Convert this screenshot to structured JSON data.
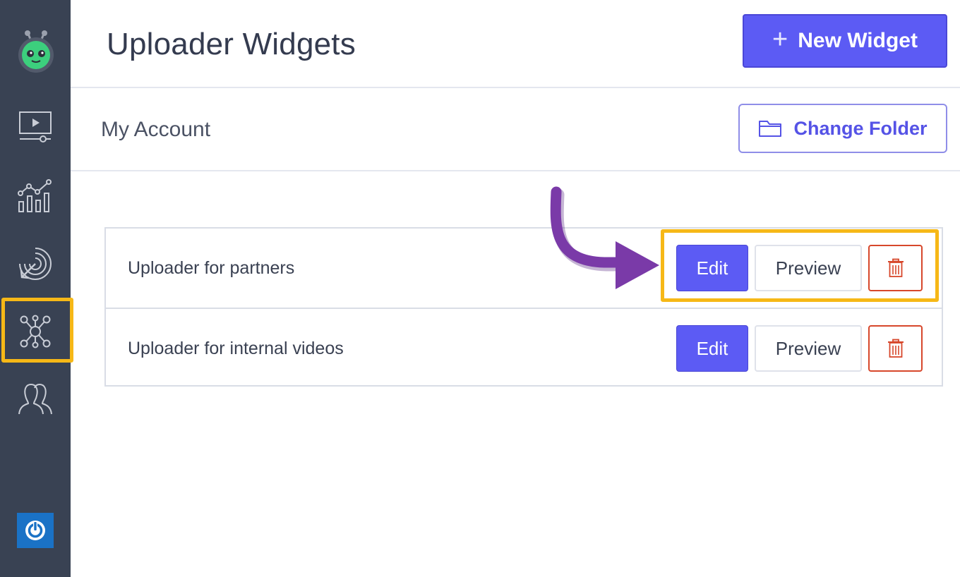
{
  "header": {
    "title": "Uploader Widgets",
    "new_widget_label": "New Widget"
  },
  "subheader": {
    "account": "My Account",
    "change_folder_label": "Change Folder"
  },
  "sidebar": {
    "items": [
      {
        "icon": "video-icon",
        "label": ""
      },
      {
        "icon": "analytics-icon",
        "label": ""
      },
      {
        "icon": "target-icon",
        "label": ""
      },
      {
        "icon": "integrations-icon",
        "label": "",
        "selected": true
      },
      {
        "icon": "users-icon",
        "label": ""
      }
    ]
  },
  "widgets": [
    {
      "name": "Uploader for partners",
      "edit_label": "Edit",
      "preview_label": "Preview"
    },
    {
      "name": "Uploader for internal videos",
      "edit_label": "Edit",
      "preview_label": "Preview"
    }
  ],
  "colors": {
    "sidebar": "#394253",
    "primary": "#5c5bf4",
    "danger": "#d7472b",
    "highlight": "#f6b817",
    "annotation_arrow": "#7a3aa8"
  }
}
